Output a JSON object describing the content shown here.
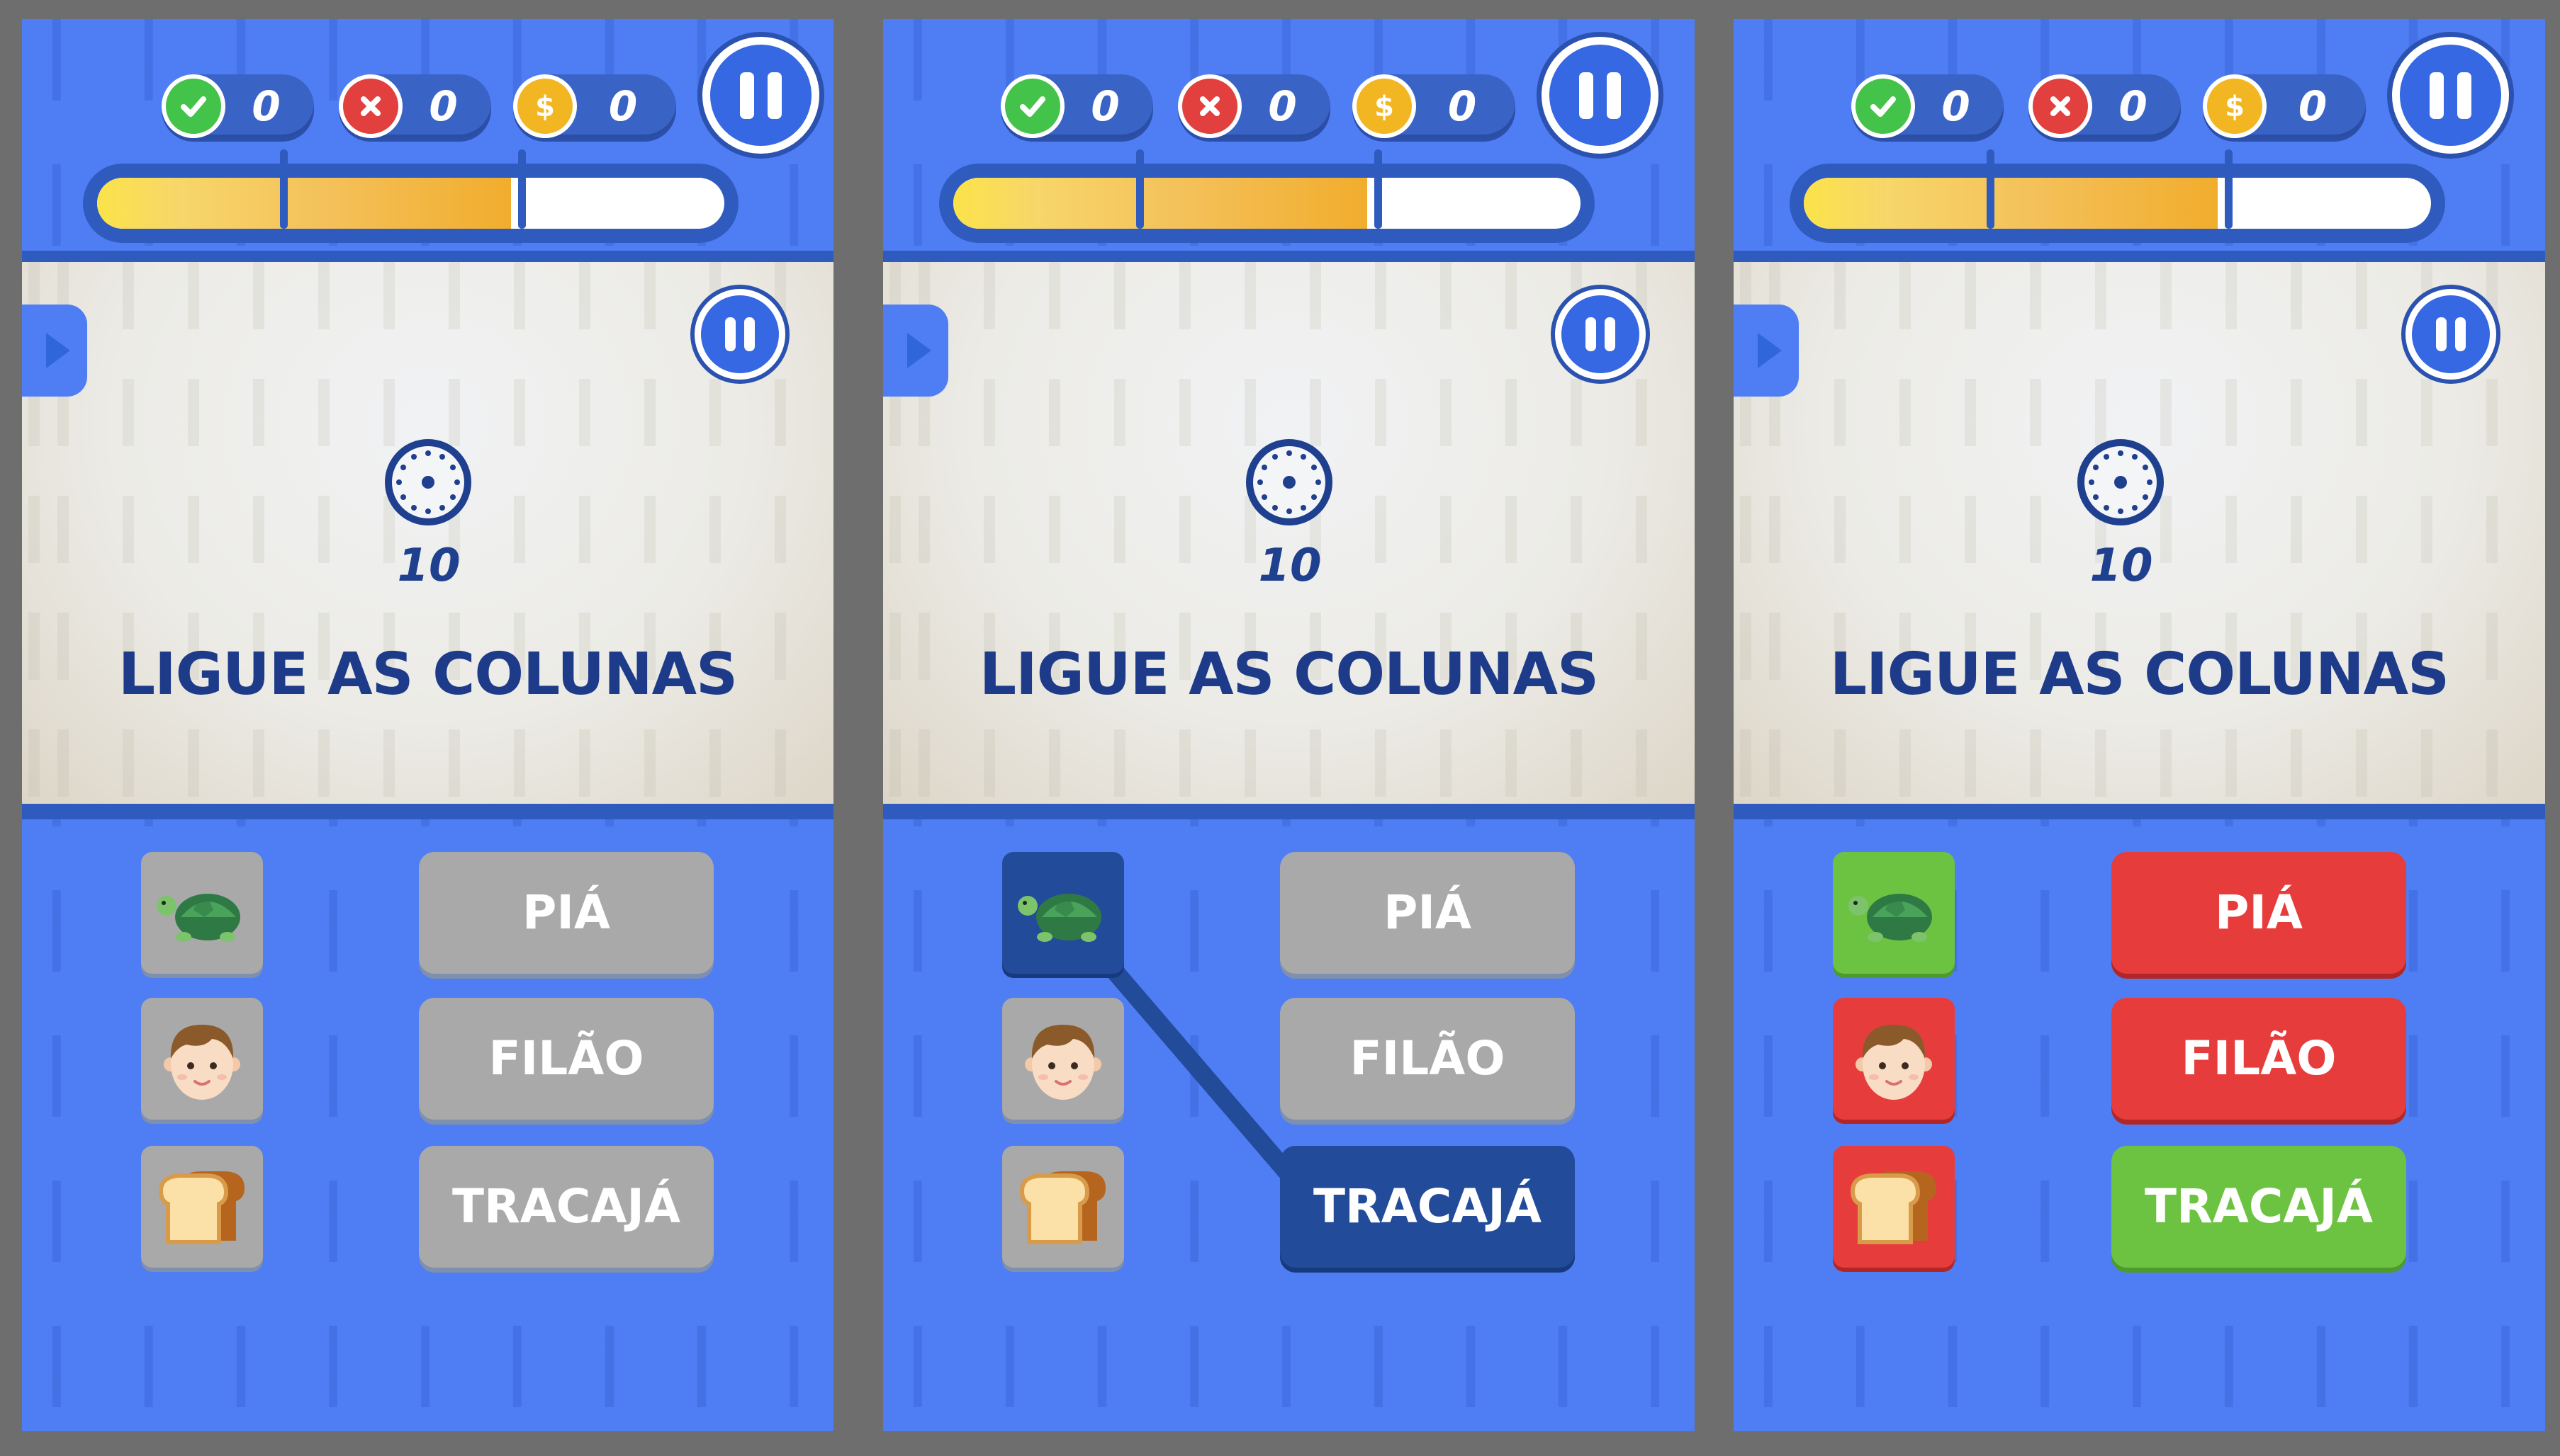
{
  "screens": [
    {
      "hud": {
        "correct": "0",
        "wrong": "0",
        "coins": "0",
        "progress": 0.66
      },
      "timer": "10",
      "title": "LIGUE AS COLUNAS",
      "images": [
        "turtle",
        "boy-face",
        "bread"
      ],
      "image_states": [
        "neutral",
        "neutral",
        "neutral"
      ],
      "words": [
        "PIÁ",
        "FILÃO",
        "TRACAJÁ"
      ],
      "word_states": [
        "neutral",
        "neutral",
        "neutral"
      ]
    },
    {
      "hud": {
        "correct": "0",
        "wrong": "0",
        "coins": "0",
        "progress": 0.66
      },
      "timer": "10",
      "title": "LIGUE AS COLUNAS",
      "images": [
        "turtle",
        "boy-face",
        "bread"
      ],
      "image_states": [
        "selected",
        "neutral",
        "neutral"
      ],
      "words": [
        "PIÁ",
        "FILÃO",
        "TRACAJÁ"
      ],
      "word_states": [
        "neutral",
        "neutral",
        "selected"
      ],
      "connection": {
        "from_image": 0,
        "to_word": 2
      }
    },
    {
      "hud": {
        "correct": "0",
        "wrong": "0",
        "coins": "0",
        "progress": 0.66
      },
      "timer": "10",
      "title": "LIGUE AS COLUNAS",
      "images": [
        "turtle",
        "boy-face",
        "bread"
      ],
      "image_states": [
        "correct",
        "wrong",
        "wrong"
      ],
      "words": [
        "PIÁ",
        "FILÃO",
        "TRACAJÁ"
      ],
      "word_states": [
        "wrong",
        "wrong",
        "correct"
      ]
    }
  ],
  "colors": {
    "neutral": "#a9a9a9",
    "selected": "#224b9a",
    "correct": "#6cc341",
    "wrong": "#e63c3c",
    "background": "#4f7ef4"
  }
}
